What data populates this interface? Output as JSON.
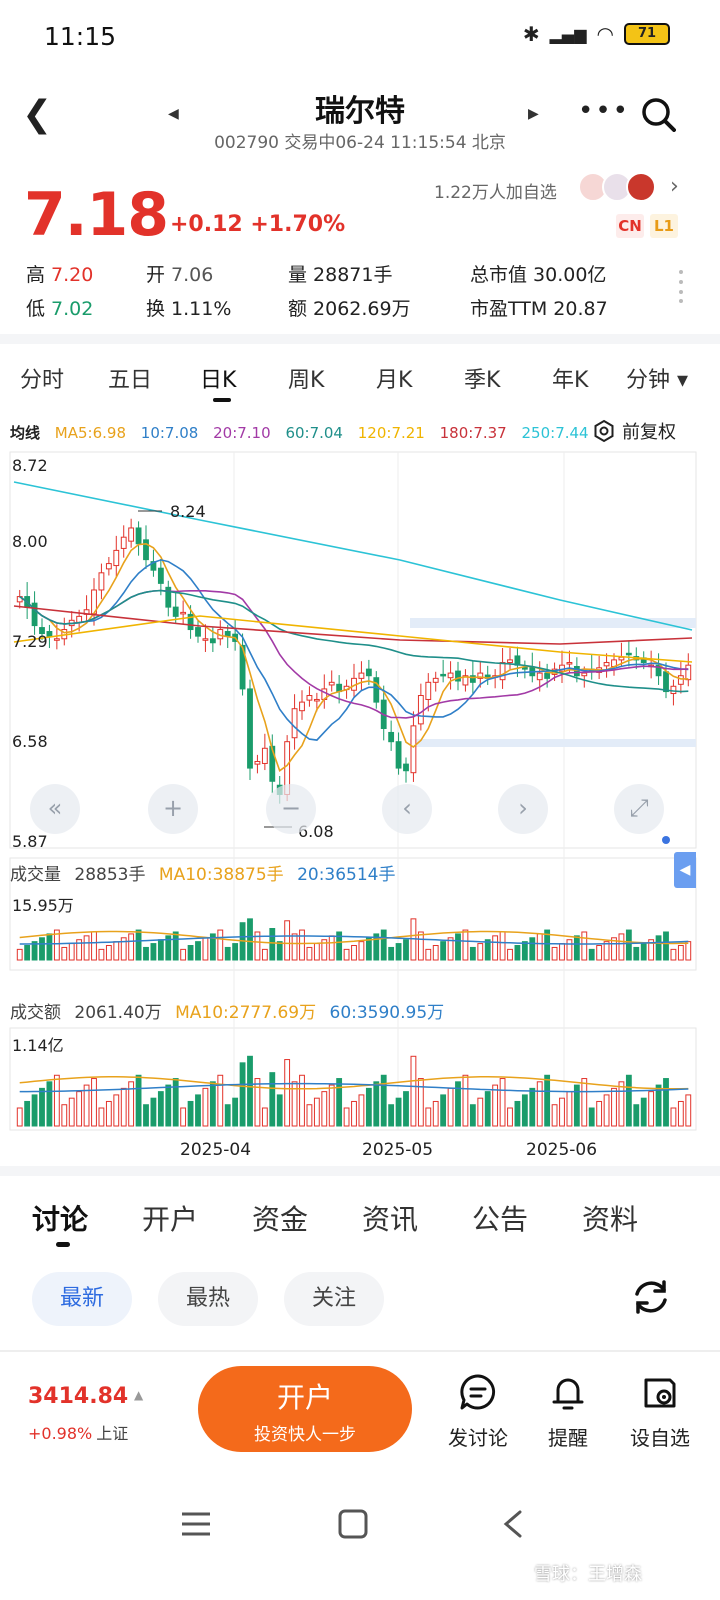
{
  "status_bar": {
    "time": "11:15",
    "battery": "71"
  },
  "header": {
    "title": "瑞尔特",
    "subtitle": "002790 交易中06-24 11:15:54 北京"
  },
  "quote": {
    "price": "7.18",
    "change": "+0.12 +1.70%",
    "followers": "1.22万人加自选",
    "badge_cn": "CN",
    "badge_l1": "L1",
    "stats": {
      "high_label": "高",
      "high": "7.20",
      "open_label": "开",
      "open": "7.06",
      "volume_label": "量",
      "volume": "28871手",
      "mcap_label": "总市值",
      "mcap": "30.00亿",
      "low_label": "低",
      "low": "7.02",
      "turnover_label": "换",
      "turnover": "1.11%",
      "amount_label": "额",
      "amount": "2062.69万",
      "pe_label": "市盈TTM",
      "pe": "20.87"
    }
  },
  "k_tabs": [
    "分时",
    "五日",
    "日K",
    "周K",
    "月K",
    "季K",
    "年K",
    "分钟 ▾"
  ],
  "active_k_tab": "日K",
  "ma_legend": {
    "title": "均线",
    "items": [
      {
        "text": "MA5:6.98",
        "color": "#e8a21c"
      },
      {
        "text": "10:7.08",
        "color": "#2f7fc8"
      },
      {
        "text": "20:7.10",
        "color": "#a23aa6"
      },
      {
        "text": "60:7.04",
        "color": "#1f8f8a"
      },
      {
        "text": "120:7.21",
        "color": "#f0b400"
      },
      {
        "text": "180:7.37",
        "color": "#c8323a"
      },
      {
        "text": "250:7.44",
        "color": "#2cc3d6"
      }
    ],
    "adjust": "前复权"
  },
  "chart_data": {
    "type": "candlestick",
    "price_axis": [
      "8.72",
      "8.00",
      "7.29",
      "6.58",
      "5.87"
    ],
    "ylim": [
      5.87,
      8.72
    ],
    "high_marker": "8.24",
    "low_marker": "6.08",
    "dates": [
      "2025-04",
      "2025-05",
      "2025-06"
    ],
    "volume": {
      "title": "成交量",
      "current": "28853手",
      "ma10": "MA10:38875手",
      "ma20": "20:36514手",
      "max_label": "15.95万"
    },
    "amount": {
      "title": "成交额",
      "current": "2061.40万",
      "ma10": "MA10:2777.69万",
      "ma60": "60:3590.95万",
      "max_label": "1.14亿"
    },
    "ma_series_colors": {
      "ma5": "#e8a21c",
      "ma10": "#2f7fc8",
      "ma20": "#a23aa6",
      "ma60": "#1f8f8a",
      "ma120": "#f0b400",
      "ma180": "#c8323a",
      "ma250": "#2cc3d6"
    },
    "colors": {
      "up": "#e2322a",
      "down": "#1a9c6b"
    }
  },
  "discussion": {
    "tabs": [
      "讨论",
      "开户",
      "资金",
      "资讯",
      "公告",
      "资料"
    ],
    "active_tab": "讨论",
    "filters": [
      "最新",
      "最热",
      "关注"
    ],
    "active_filter": "最新"
  },
  "bottom_bar": {
    "index_value": "3414.84",
    "index_change": "+0.98%",
    "index_name": "上证",
    "open_title": "开户",
    "open_sub": "投资快人一步",
    "actions": [
      "发讨论",
      "提醒",
      "设自选"
    ]
  },
  "watermark": "雪球：王增森"
}
